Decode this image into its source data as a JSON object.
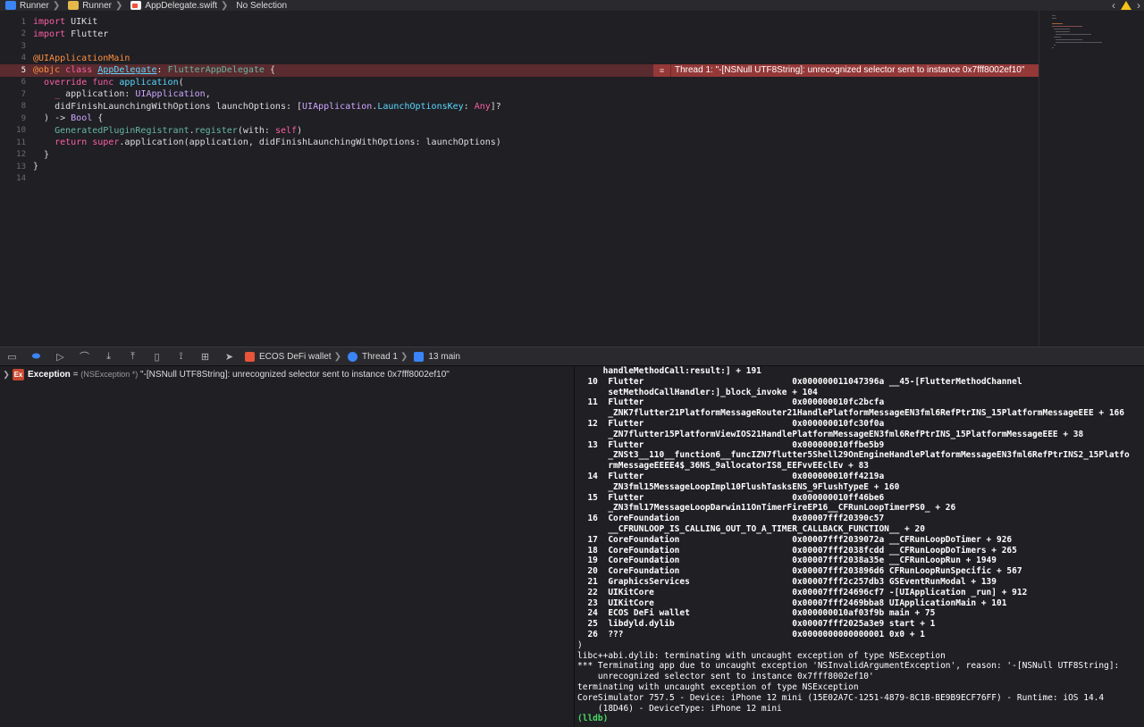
{
  "breadcrumb": {
    "items": [
      {
        "label": "Runner",
        "icon": "project-icon"
      },
      {
        "label": "Runner",
        "icon": "folder-icon"
      },
      {
        "label": "AppDelegate.swift",
        "icon": "swift-file-icon"
      },
      {
        "label": "No Selection",
        "icon": ""
      }
    ]
  },
  "editor": {
    "lines": [
      {
        "n": "1",
        "segs": [
          [
            "kw",
            "import"
          ],
          [
            "plain",
            " UIKit"
          ]
        ]
      },
      {
        "n": "2",
        "segs": [
          [
            "kw",
            "import"
          ],
          [
            "plain",
            " Flutter"
          ]
        ]
      },
      {
        "n": "3",
        "segs": []
      },
      {
        "n": "4",
        "segs": [
          [
            "attr",
            "@UIApplicationMain"
          ]
        ]
      },
      {
        "n": "5",
        "segs": [
          [
            "attr",
            "@objc"
          ],
          [
            "plain",
            " "
          ],
          [
            "kw",
            "class"
          ],
          [
            "plain",
            " "
          ],
          [
            "ty ul",
            "AppDelegate"
          ],
          [
            "plain",
            ": "
          ],
          [
            "fn",
            "FlutterAppDelegate"
          ],
          [
            "plain",
            " {"
          ]
        ],
        "error": true
      },
      {
        "n": "6",
        "segs": [
          [
            "plain",
            "  "
          ],
          [
            "kw",
            "override"
          ],
          [
            "plain",
            " "
          ],
          [
            "kw",
            "func"
          ],
          [
            "plain",
            " "
          ],
          [
            "ty",
            "application"
          ],
          [
            "plain",
            "("
          ]
        ]
      },
      {
        "n": "7",
        "segs": [
          [
            "plain",
            "    "
          ],
          [
            "kw",
            "_"
          ],
          [
            "plain",
            " application: "
          ],
          [
            "cls",
            "UIApplication"
          ],
          [
            "plain",
            ","
          ]
        ]
      },
      {
        "n": "8",
        "segs": [
          [
            "plain",
            "    didFinishLaunchingWithOptions launchOptions: ["
          ],
          [
            "cls",
            "UIApplication"
          ],
          [
            "plain",
            "."
          ],
          [
            "ty",
            "LaunchOptionsKey"
          ],
          [
            "plain",
            ": "
          ],
          [
            "kw",
            "Any"
          ],
          [
            "plain",
            "]?"
          ]
        ]
      },
      {
        "n": "9",
        "segs": [
          [
            "plain",
            "  ) -> "
          ],
          [
            "cls",
            "Bool"
          ],
          [
            "plain",
            " {"
          ]
        ]
      },
      {
        "n": "10",
        "segs": [
          [
            "plain",
            "    "
          ],
          [
            "fn",
            "GeneratedPluginRegistrant"
          ],
          [
            "plain",
            "."
          ],
          [
            "fn",
            "register"
          ],
          [
            "plain",
            "(with: "
          ],
          [
            "kw",
            "self"
          ],
          [
            "plain",
            ")"
          ]
        ]
      },
      {
        "n": "11",
        "segs": [
          [
            "plain",
            "    "
          ],
          [
            "kw",
            "return"
          ],
          [
            "plain",
            " "
          ],
          [
            "kw",
            "super"
          ],
          [
            "plain",
            ".application(application, didFinishLaunchingWithOptions: launchOptions)"
          ]
        ]
      },
      {
        "n": "12",
        "segs": [
          [
            "plain",
            "  }"
          ]
        ]
      },
      {
        "n": "13",
        "segs": [
          [
            "plain",
            "}"
          ]
        ]
      },
      {
        "n": "14",
        "segs": []
      }
    ],
    "error_message": "Thread 1: \"-[NSNull UTF8String]: unrecognized selector sent to instance 0x7fff8002ef10\""
  },
  "debug_bar": {
    "app_name": "ECOS DeFi wallet",
    "thread": "Thread 1",
    "frame": "13 main"
  },
  "variables": {
    "name": "Exception",
    "equals": " = ",
    "type": "(NSException *)",
    "value": " \"-[NSNull UTF8String]: unrecognized selector sent to instance 0x7fff8002ef10\""
  },
  "console": {
    "lines": [
      "     handleMethodCall:result:] + 191",
      "  10  Flutter                             0x000000011047396a __45-[FlutterMethodChannel",
      "      setMethodCallHandler:]_block_invoke + 104",
      "  11  Flutter                             0x000000010fc2bcfa",
      "      _ZNK7flutter21PlatformMessageRouter21HandlePlatformMessageEN3fml6RefPtrINS_15PlatformMessageEEE + 166",
      "  12  Flutter                             0x000000010fc30f0a",
      "      _ZN7flutter15PlatformViewIOS21HandlePlatformMessageEN3fml6RefPtrINS_15PlatformMessageEEE + 38",
      "  13  Flutter                             0x000000010ffbe5b9",
      "      _ZNSt3__110__function6__funcIZN7flutter5Shell29OnEngineHandlePlatformMessageEN3fml6RefPtrINS2_15Platfo",
      "      rmMessageEEEE4$_36NS_9allocatorIS8_EEFvvEEclEv + 83",
      "  14  Flutter                             0x000000010ff4219a",
      "      _ZN3fml15MessageLoopImpl10FlushTasksENS_9FlushTypeE + 160",
      "  15  Flutter                             0x000000010ff46be6",
      "      _ZN3fml17MessageLoopDarwin11OnTimerFireEP16__CFRunLoopTimerPS0_ + 26",
      "  16  CoreFoundation                      0x00007fff20390c57",
      "      __CFRUNLOOP_IS_CALLING_OUT_TO_A_TIMER_CALLBACK_FUNCTION__ + 20",
      "  17  CoreFoundation                      0x00007fff2039072a __CFRunLoopDoTimer + 926",
      "  18  CoreFoundation                      0x00007fff2038fcdd __CFRunLoopDoTimers + 265",
      "  19  CoreFoundation                      0x00007fff2038a35e __CFRunLoopRun + 1949",
      "  20  CoreFoundation                      0x00007fff203896d6 CFRunLoopRunSpecific + 567",
      "  21  GraphicsServices                    0x00007fff2c257db3 GSEventRunModal + 139",
      "  22  UIKitCore                           0x00007fff24696cf7 -[UIApplication _run] + 912",
      "  23  UIKitCore                           0x00007fff2469bba8 UIApplicationMain + 101",
      "  24  ECOS DeFi wallet                    0x000000010af03f9b main + 75",
      "  25  libdyld.dylib                       0x00007fff2025a3e9 start + 1",
      "  26  ???                                 0x0000000000000001 0x0 + 1",
      ")",
      "libc++abi.dylib: terminating with uncaught exception of type NSException",
      "*** Terminating app due to uncaught exception 'NSInvalidArgumentException', reason: '-[NSNull UTF8String]:",
      "    unrecognized selector sent to instance 0x7fff8002ef10'",
      "terminating with uncaught exception of type NSException",
      "CoreSimulator 757.5 - Device: iPhone 12 mini (15E02A7C-1251-4879-8C1B-BE9B9ECF76FF) - Runtime: iOS 14.4",
      "    (18D46) - DeviceType: iPhone 12 mini",
      "(lldb)"
    ]
  },
  "colors": {
    "error_banner": "#943838",
    "error_line": "#5a2b2f",
    "prompt": "#4cd964",
    "accent": "#3b84f5"
  }
}
